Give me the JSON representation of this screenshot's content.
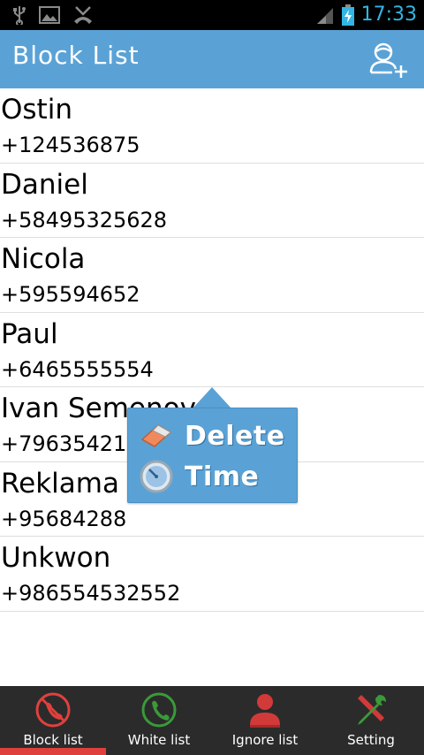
{
  "status_bar": {
    "time": "17:33"
  },
  "header": {
    "title": "Block List"
  },
  "contacts": [
    {
      "name": "Ostin",
      "phone": "+124536875"
    },
    {
      "name": "Daniel",
      "phone": "+58495325628"
    },
    {
      "name": "Nicola",
      "phone": "+595594652"
    },
    {
      "name": "Paul",
      "phone": "+6465555554"
    },
    {
      "name": "Ivan Semenov",
      "phone": "+796354214"
    },
    {
      "name": "Reklama",
      "phone": "+95684288"
    },
    {
      "name": "Unkwon",
      "phone": "+986554532552"
    }
  ],
  "popup": {
    "delete_label": "Delete",
    "time_label": "Time"
  },
  "tabs": [
    {
      "label": "Block list",
      "icon": "block-phone-icon",
      "active": true
    },
    {
      "label": "White list",
      "icon": "white-phone-icon",
      "active": false
    },
    {
      "label": "Ignore list",
      "icon": "ignore-person-icon",
      "active": false
    },
    {
      "label": "Setting",
      "icon": "tools-icon",
      "active": false
    }
  ],
  "colors": {
    "accent": "#5aa2d6",
    "status_time": "#33b5e5",
    "active_tab": "#e0403d",
    "tab_bar": "#2b2b2b"
  }
}
